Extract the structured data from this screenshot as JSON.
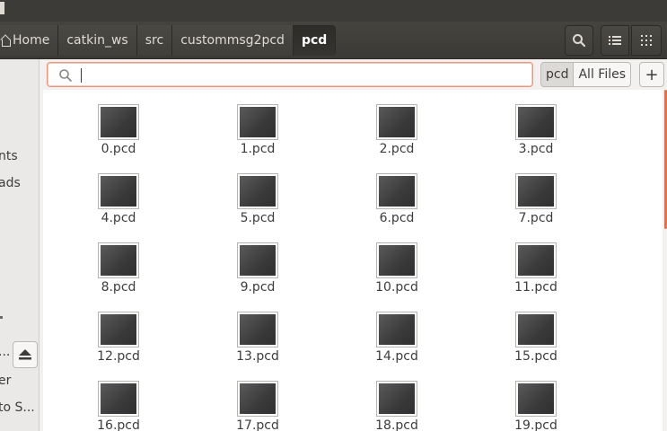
{
  "header": {
    "breadcrumbs": [
      "Home",
      "catkin_ws",
      "src",
      "custommsg2pcd",
      "pcd"
    ]
  },
  "sidebar": {
    "items": [
      "nts",
      "ads",
      "...",
      "er",
      "to S..."
    ]
  },
  "search": {
    "value": "",
    "placeholder": ""
  },
  "filters": [
    "pcd",
    "All Files"
  ],
  "add_label": "+",
  "files": [
    "0.pcd",
    "1.pcd",
    "2.pcd",
    "3.pcd",
    "4.pcd",
    "5.pcd",
    "6.pcd",
    "7.pcd",
    "8.pcd",
    "9.pcd",
    "10.pcd",
    "11.pcd",
    "12.pcd",
    "13.pcd",
    "14.pcd",
    "15.pcd",
    "16.pcd",
    "17.pcd",
    "18.pcd",
    "19.pcd"
  ],
  "icons": [
    "home-icon",
    "search-icon",
    "list-view-icon",
    "grid-view-icon",
    "eject-icon",
    "magnifier-icon",
    "file-thumbnail-icon"
  ],
  "colors": {
    "accent": "#e2724a",
    "header": "#3c3b37"
  }
}
